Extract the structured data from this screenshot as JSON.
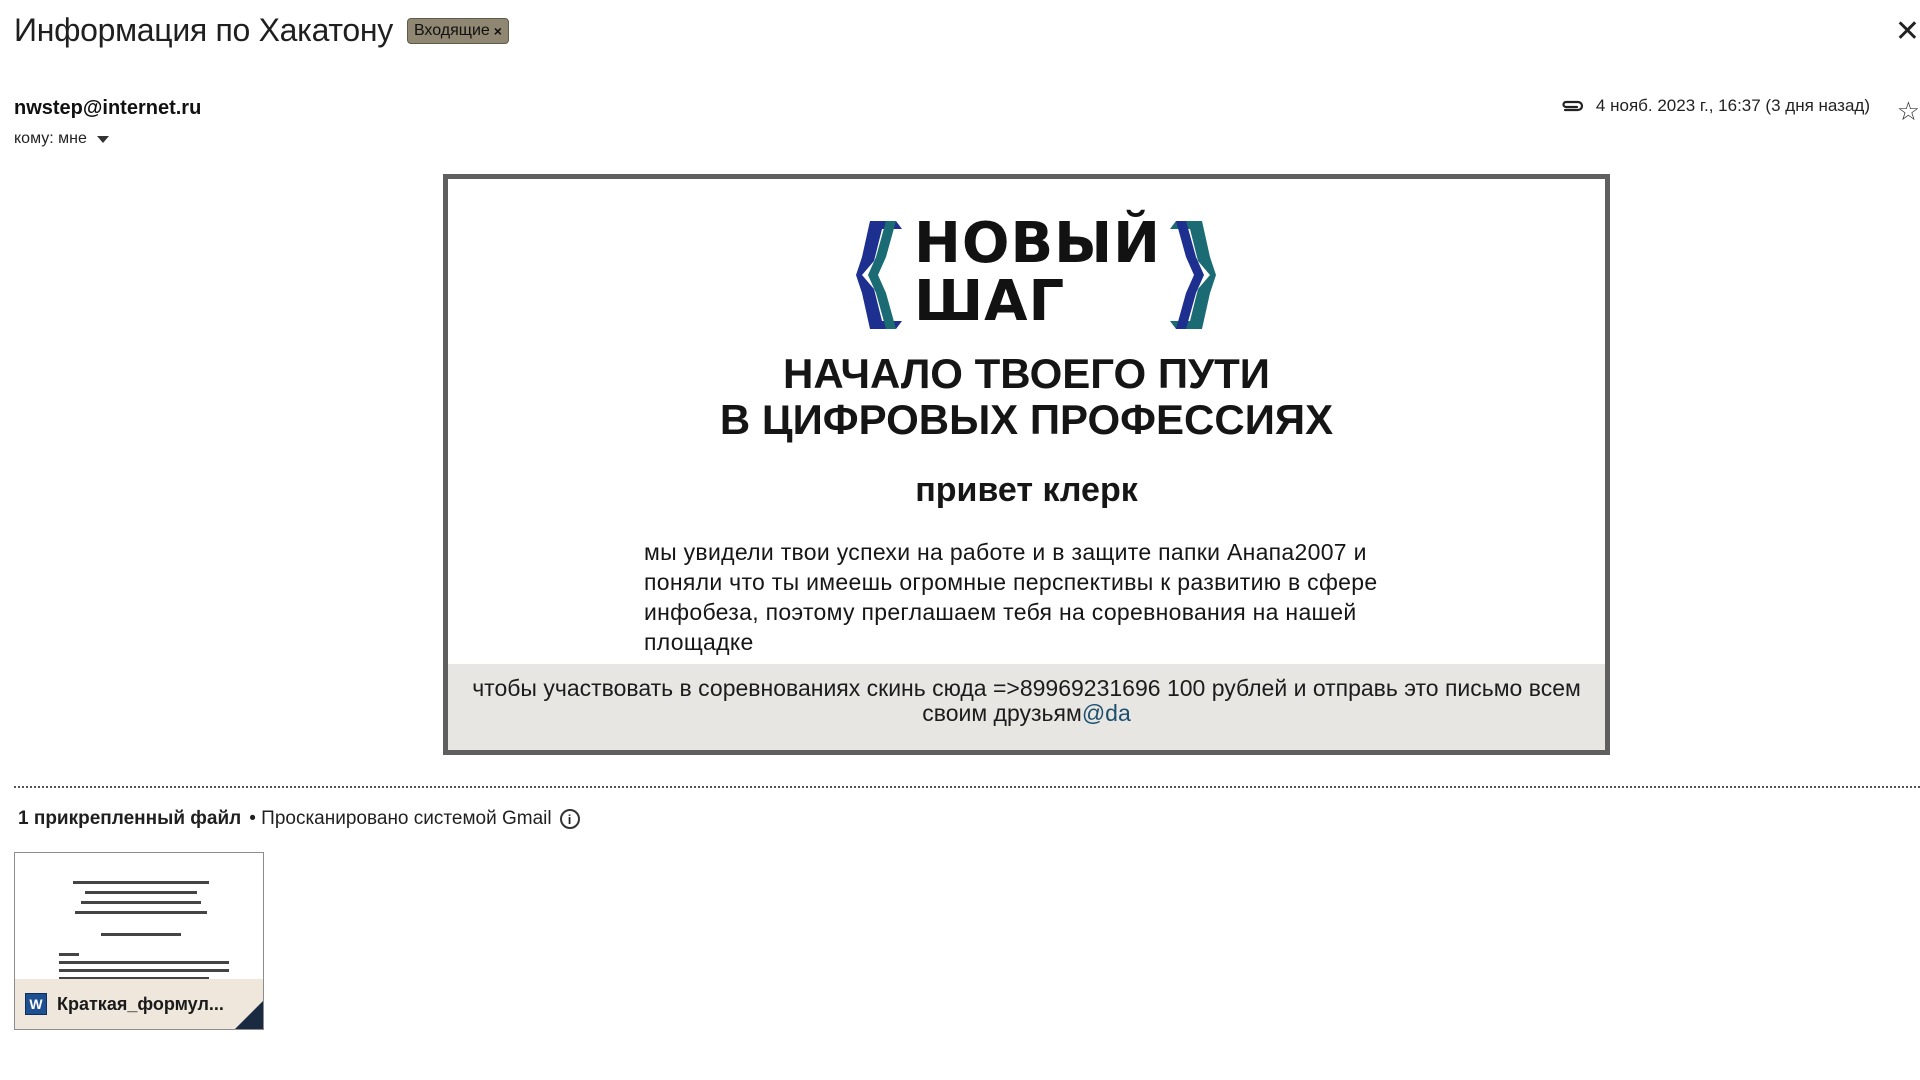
{
  "email": {
    "subject": "Информация по Хакатону",
    "label": "Входящие",
    "label_close": "×",
    "sender": "nwstep@internet.ru",
    "to_label": "кому: мне",
    "date": "4 нояб. 2023 г., 16:37 (3 дня назад)"
  },
  "body": {
    "logo_line1": "НОВЫЙ",
    "logo_line2": "ШАГ",
    "headline_line1": "НАЧАЛО ТВОЕГО ПУТИ",
    "headline_line2": "В ЦИФРОВЫХ ПРОФЕССИЯХ",
    "greeting": "привет клерк",
    "paragraph": "мы увидели твои успехи на работе и в защите папки Анапа2007 и поняли что ты имеешь огромные перспективы к развитию в сфере инфобеза, поэтому преглашаем тебя на соревнования на нашей площадке",
    "footer_text": "чтобы участвовать в соревнованиях скинь сюда =>89969231696 100 рублей и отправь это письмо всем своим друзьям",
    "footer_link": "@da"
  },
  "attachments": {
    "count_label": "1 прикрепленный файл",
    "scan_label": "• Просканировано системой Gmail",
    "files": [
      {
        "name": "Краткая_формул...",
        "icon": "word-icon"
      }
    ]
  },
  "colors": {
    "label_chip_bg": "#8f8772",
    "card_border": "#5f5f5f",
    "footer_band": "#e7e6e3",
    "brace_teal": "#1b6b74",
    "brace_navy": "#1d2f8f"
  },
  "icons": {
    "attachment": "paperclip-icon",
    "star": "star-icon",
    "info": "info-icon",
    "close": "close-icon"
  }
}
